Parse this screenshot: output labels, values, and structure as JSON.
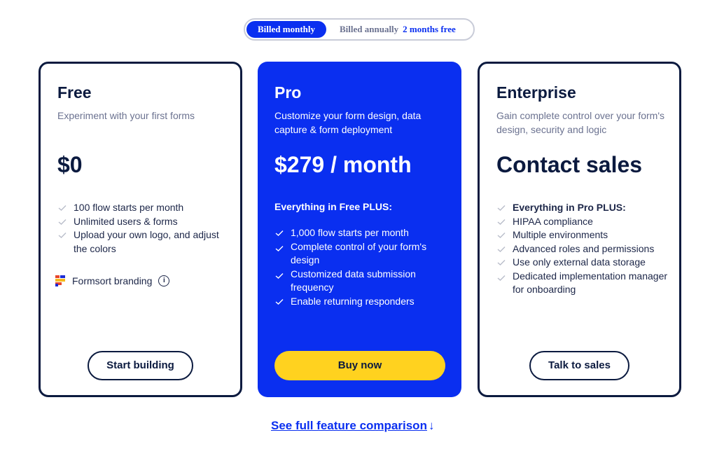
{
  "billing_toggle": {
    "monthly_label": "Billed monthly",
    "annual_label": "Billed annually",
    "annual_promo": "2 months free",
    "selected": "monthly"
  },
  "plans": {
    "free": {
      "title": "Free",
      "description": "Experiment with your first forms",
      "price": "$0",
      "features": [
        "100 flow starts per month",
        "Unlimited users & forms",
        "Upload your own logo, and adjust the colors"
      ],
      "branding_label": "Formsort branding",
      "cta_label": "Start building"
    },
    "pro": {
      "title": "Pro",
      "description": "Customize your form design, data capture & form deployment",
      "price": "$279 / month",
      "lead": "Everything in Free PLUS:",
      "features": [
        "1,000 flow starts per month",
        "Complete control of your form's design",
        "Customized data submission frequency",
        "Enable returning responders"
      ],
      "cta_label": "Buy now"
    },
    "enterprise": {
      "title": "Enterprise",
      "description": "Gain complete control over your form's design, security and logic",
      "price": "Contact sales",
      "features": [
        "Everything in Pro PLUS:",
        "HIPAA compliance",
        "Multiple environments",
        "Advanced roles and permissions",
        "Use only external data storage",
        "Dedicated implementation manager for onboarding"
      ],
      "cta_label": "Talk to sales"
    }
  },
  "comparison_link": "See full feature comparison",
  "comparison_arrow": "↓",
  "colors": {
    "brand_blue": "#0a2ff0",
    "navy": "#0b1a3f",
    "cta_yellow": "#ffd21f",
    "muted_text": "#6b7290"
  },
  "icons": [
    "check-icon",
    "formsort-logo-icon",
    "info-icon",
    "arrow-down-icon"
  ]
}
